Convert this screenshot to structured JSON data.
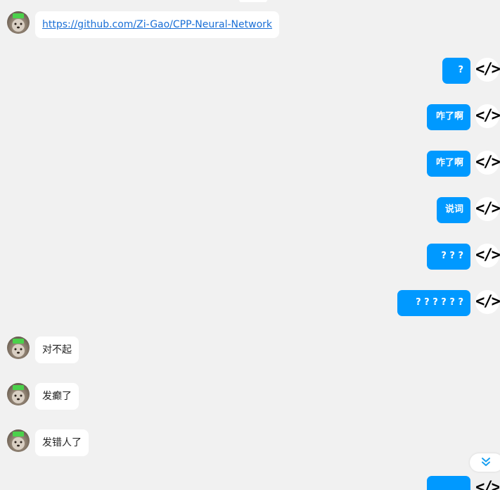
{
  "messages": {
    "m1": {
      "text": "https://github.com/Zi-Gao/CPP-Neural-Network"
    },
    "m2": {
      "text": "?"
    },
    "m3": {
      "text": "咋了啊"
    },
    "m4": {
      "text": "咋了啊"
    },
    "m5": {
      "text": "说词"
    },
    "m6": {
      "text": "? ? ?"
    },
    "m7": {
      "text": "? ? ? ? ? ?"
    },
    "m8": {
      "text": "对不起"
    },
    "m9": {
      "text": "发癫了"
    },
    "m10": {
      "text": "发错人了"
    }
  },
  "icons": {
    "outgoing_avatar": "code-icon",
    "incoming_avatar": "avatar",
    "scroll": "double-chevron-down-icon"
  },
  "colors": {
    "background": "#f1f1f1",
    "outgoing_bubble": "#0099ff",
    "incoming_bubble": "#ffffff",
    "link": "#1a6fd6"
  }
}
